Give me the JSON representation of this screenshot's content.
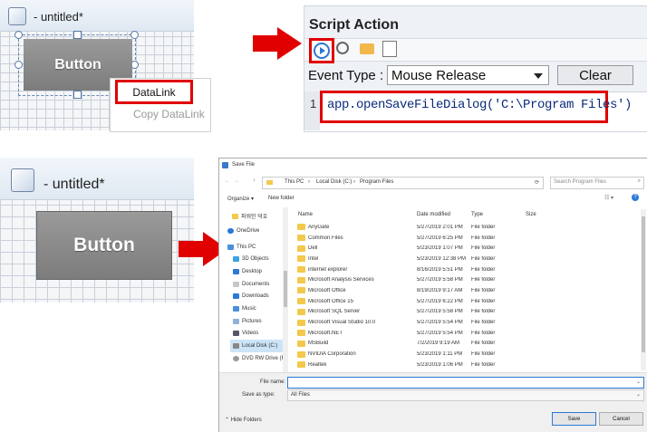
{
  "editor_top": {
    "title": "- untitled*",
    "button_label": "Button"
  },
  "context_menu": {
    "items": [
      "DataLink",
      "Copy DataLink"
    ]
  },
  "script_action": {
    "title": "Script Action",
    "event_type_label": "Event Type :",
    "event_type_value": "Mouse Release",
    "clear_label": "Clear",
    "line_number": "1",
    "code": "app.openSaveFileDialog('C:\\Program Files')"
  },
  "editor_bottom": {
    "title": "- untitled*",
    "button_label": "Button"
  },
  "save_dialog": {
    "title": "Save File",
    "breadcrumb": [
      "This PC",
      "Local Disk (C:)",
      "Program Files"
    ],
    "search_placeholder": "Search Program Files",
    "organize_label": "Organize ▾",
    "new_folder_label": "New folder",
    "nav_items": [
      "파워인 덕호",
      "OneDrive",
      "This PC",
      "3D Objects",
      "Desktop",
      "Documents",
      "Downloads",
      "Music",
      "Pictures",
      "Videos",
      "Local Disk (C:)",
      "DVD RW Drive (F"
    ],
    "columns": [
      "Name",
      "Date modified",
      "Type",
      "Size"
    ],
    "files": [
      {
        "name": "AnyGate",
        "date": "5/27/2019 2:01 PM",
        "type": "File folder"
      },
      {
        "name": "Common Files",
        "date": "5/27/2019 6:25 PM",
        "type": "File folder"
      },
      {
        "name": "Dell",
        "date": "5/23/2019 1:07 PM",
        "type": "File folder"
      },
      {
        "name": "Intel",
        "date": "5/23/2019 12:38 PM",
        "type": "File folder"
      },
      {
        "name": "internet explorer",
        "date": "8/16/2019 5:51 PM",
        "type": "File folder"
      },
      {
        "name": "Microsoft Analysis Services",
        "date": "5/27/2019 5:58 PM",
        "type": "File folder"
      },
      {
        "name": "Microsoft Office",
        "date": "8/19/2019 9:17 AM",
        "type": "File folder"
      },
      {
        "name": "Microsoft Office 15",
        "date": "5/27/2019 6:22 PM",
        "type": "File folder"
      },
      {
        "name": "Microsoft SQL Server",
        "date": "5/27/2019 5:58 PM",
        "type": "File folder"
      },
      {
        "name": "Microsoft Visual Studio 10.0",
        "date": "5/27/2019 5:54 PM",
        "type": "File folder"
      },
      {
        "name": "Microsoft.NET",
        "date": "5/27/2019 5:54 PM",
        "type": "File folder"
      },
      {
        "name": "MSBuild",
        "date": "7/2/2019 9:19 AM",
        "type": "File folder"
      },
      {
        "name": "NVIDIA Corporation",
        "date": "5/23/2019 1:11 PM",
        "type": "File folder"
      },
      {
        "name": "Realtek",
        "date": "5/23/2019 1:06 PM",
        "type": "File folder"
      }
    ],
    "file_name_label": "File name:",
    "file_name_value": "",
    "save_type_label": "Save as type:",
    "save_type_value": "All Files",
    "hide_folders_label": "Hide Folders",
    "save_label": "Save",
    "cancel_label": "Cancel"
  },
  "colors": {
    "accent_red": "#e00000",
    "button_gray": "#8a8a8a",
    "folder_yellow": "#f2c94c"
  }
}
